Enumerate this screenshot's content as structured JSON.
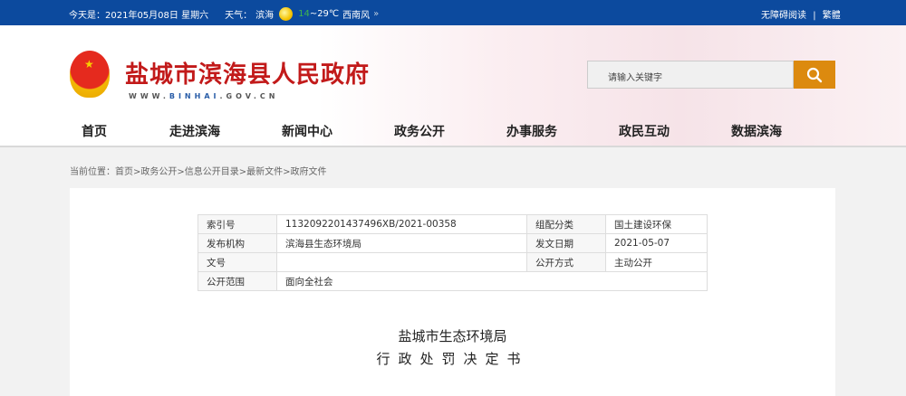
{
  "topbar": {
    "date": "今天是：2021年05月08日 星期六",
    "weather_label": "天气：",
    "city": "滨海",
    "temp_low": "14",
    "temp_high": "~29℃",
    "wind": "西南风",
    "more": "»",
    "accessible": "无障碍阅读",
    "sep": "|",
    "traditional": "繁體"
  },
  "header": {
    "site_title": "盐城市滨海县人民政府",
    "url_pre": "WWW.",
    "url_mid": "BINHAI",
    "url_post": ".GOV.CN",
    "search_placeholder": "请输入关键字"
  },
  "nav": [
    "首页",
    "走进滨海",
    "新闻中心",
    "政务公开",
    "办事服务",
    "政民互动",
    "数据滨海"
  ],
  "breadcrumb": "当前位置：首页>政务公开>信息公开目录>最新文件>政府文件",
  "meta": {
    "rows": [
      [
        "索引号",
        "113209220143749 6XB/2021-00358",
        "组配分类",
        "国土建设环保"
      ],
      [
        "发布机构",
        "滨海县生态环境局",
        "发文日期",
        "2021-05-07"
      ],
      [
        "文号",
        "",
        "公开方式",
        "主动公开"
      ],
      [
        "公开范围",
        "面向全社会"
      ]
    ]
  },
  "doc": {
    "org": "盐城市生态环境局",
    "type": "行政处罚决定书"
  },
  "colors": {
    "topbar": "#0c4a9e",
    "title": "#c21a1a",
    "search_btn": "#dc8a0f"
  }
}
